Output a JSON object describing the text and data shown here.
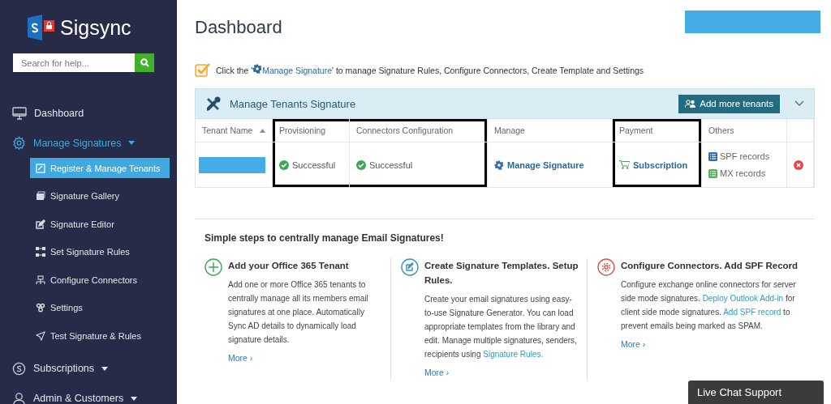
{
  "sidebar": {
    "logo": "Sigsync",
    "search": {
      "placeholder": "Search for help..."
    },
    "items": [
      {
        "label": "Dashboard",
        "selected": false
      },
      {
        "label": "Manage Signatures",
        "selected": false,
        "expanded": true,
        "children": [
          {
            "label": "Register & Manage Tenants",
            "selected": true
          },
          {
            "label": "Signature Gallery",
            "selected": false
          },
          {
            "label": "Signature Editor",
            "selected": false
          },
          {
            "label": "Set Signature Rules",
            "selected": false
          },
          {
            "label": "Configure Connectors",
            "selected": false
          },
          {
            "label": "Settings",
            "selected": false
          },
          {
            "label": "Test Signature & Rules",
            "selected": false
          }
        ]
      },
      {
        "label": "Subscriptions",
        "selected": false,
        "expanded": false
      },
      {
        "label": "Admin & Customers",
        "selected": false,
        "expanded": false
      }
    ]
  },
  "header": {
    "title": "Dashboard"
  },
  "hint": {
    "checked": true,
    "parts": [
      {
        "kind": "text",
        "text": "Click the '"
      },
      {
        "kind": "link",
        "text": "Manage Signature"
      },
      {
        "kind": "text",
        "text": "' to manage Signature Rules, Configure Connectors, Create Template and Settings"
      }
    ]
  },
  "panel": {
    "title": "Manage Tenants Signature",
    "button": "Add more tenants",
    "expanded": true,
    "table": {
      "columns": [
        {
          "label": "Tenant Name",
          "sorted": true,
          "outlined": false
        },
        {
          "label": "Provisioning",
          "outlined": true
        },
        {
          "label": "Connectors Configuration",
          "outlined": true
        },
        {
          "label": "Manage",
          "outlined": false
        },
        {
          "label": "Payment",
          "outlined": true
        },
        {
          "label": "Others",
          "outlined": false
        },
        {
          "outlined": false
        }
      ],
      "rows": [
        {
          "cells": [
            {
              "kind": "redacted"
            },
            {
              "kind": "status",
              "text": "Successful"
            },
            {
              "kind": "status",
              "text": "Successful"
            },
            {
              "kind": "manage",
              "text": "Manage Signature"
            },
            {
              "kind": "cart",
              "text": "Subscription"
            },
            {
              "kind": "records",
              "items": [
                {
                  "text": "SPF records",
                  "color": "#3d6ea6"
                },
                {
                  "text": "MX records",
                  "color": "#4fb84f"
                }
              ]
            },
            {
              "kind": "delete"
            }
          ]
        }
      ]
    }
  },
  "steps": {
    "title": "Simple steps to centrally manage Email Signatures!",
    "items": [
      {
        "title": "Add your Office 365 Tenant",
        "color": "#3aa757",
        "body": [
          {
            "kind": "text",
            "text": "Add one or more Office 365 tenants to centrally manage all its members email signatures at one place. Automatically Sync AD details to dynamically load signature details."
          }
        ],
        "more": "More ›"
      },
      {
        "title": "Create Signature Templates. Setup Rules.",
        "color": "#3c8fc4",
        "body": [
          {
            "kind": "text",
            "text": "Create your email signatures using easy-to-use Signature Generator. You can load appropriate templates from the library and edit. Manage multiple signatures, senders, recipients using "
          },
          {
            "kind": "link",
            "text": "Signature Rules."
          }
        ],
        "more": "More ›"
      },
      {
        "title": "Configure Connectors. Add SPF Record",
        "color": "#d9534f",
        "body": [
          {
            "kind": "text",
            "text": "Configure exchange online connectors for server side mode signatures. "
          },
          {
            "kind": "link",
            "text": "Deploy Outlook Add-in"
          },
          {
            "kind": "text",
            "text": " for client side mode signatures. "
          },
          {
            "kind": "link",
            "text": "Add SPF record"
          },
          {
            "kind": "text",
            "text": " to prevent emails being marked as SPAM."
          }
        ],
        "more": "More ›"
      }
    ]
  },
  "chat": {
    "label": "Live Chat Support"
  }
}
